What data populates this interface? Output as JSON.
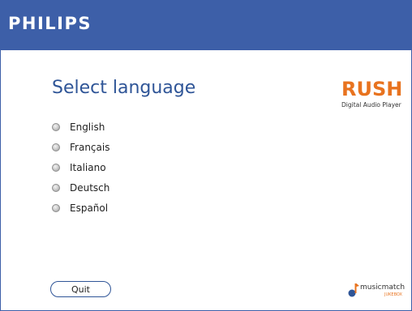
{
  "app": {
    "brand": "PHILIPS",
    "title": "Select language"
  },
  "logo": {
    "rush_word": "RUSH",
    "rush_subtitle": "Digital Audio Player",
    "musicmatch_word": "musicmatch",
    "musicmatch_sub": "JUKEBOX"
  },
  "languages": [
    {
      "label": "English"
    },
    {
      "label": "Français"
    },
    {
      "label": "Italiano"
    },
    {
      "label": "Deutsch"
    },
    {
      "label": "Español"
    }
  ],
  "buttons": {
    "quit_label": "Quit"
  },
  "colors": {
    "header_bg": "#3d5fa8",
    "title": "#2f5597",
    "accent_orange": "#e8731f"
  }
}
